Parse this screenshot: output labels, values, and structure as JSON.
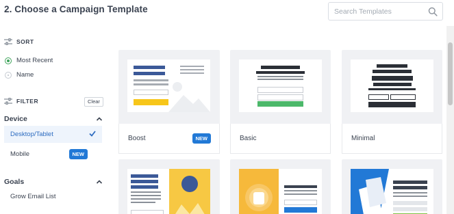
{
  "header": {
    "title": "2. Choose a Campaign Template",
    "search_placeholder": "Search Templates",
    "search_value": ""
  },
  "sidebar": {
    "sort": {
      "label": "SORT",
      "options": [
        {
          "label": "Most Recent",
          "selected": true
        },
        {
          "label": "Name",
          "selected": false
        }
      ]
    },
    "filter": {
      "label": "FILTER",
      "clear_label": "Clear"
    },
    "device": {
      "label": "Device",
      "expanded": true,
      "items": [
        {
          "label": "Desktop/Tablet",
          "selected": true
        },
        {
          "label": "Mobile",
          "badge": "NEW"
        }
      ]
    },
    "goals": {
      "label": "Goals",
      "expanded": true,
      "items": [
        {
          "label": "Grow Email List"
        }
      ]
    }
  },
  "templates": [
    {
      "name": "Boost",
      "badge": "NEW"
    },
    {
      "name": "Basic"
    },
    {
      "name": "Minimal"
    }
  ],
  "colors": {
    "accent_blue": "#2279d6",
    "check_blue": "#2d6cc0",
    "radio_green": "#3da35a",
    "boost_yellow": "#f7c61a",
    "basic_green": "#4cb86a",
    "thumb_navy": "#3b5998",
    "thumb_dark": "#2b2f36"
  }
}
